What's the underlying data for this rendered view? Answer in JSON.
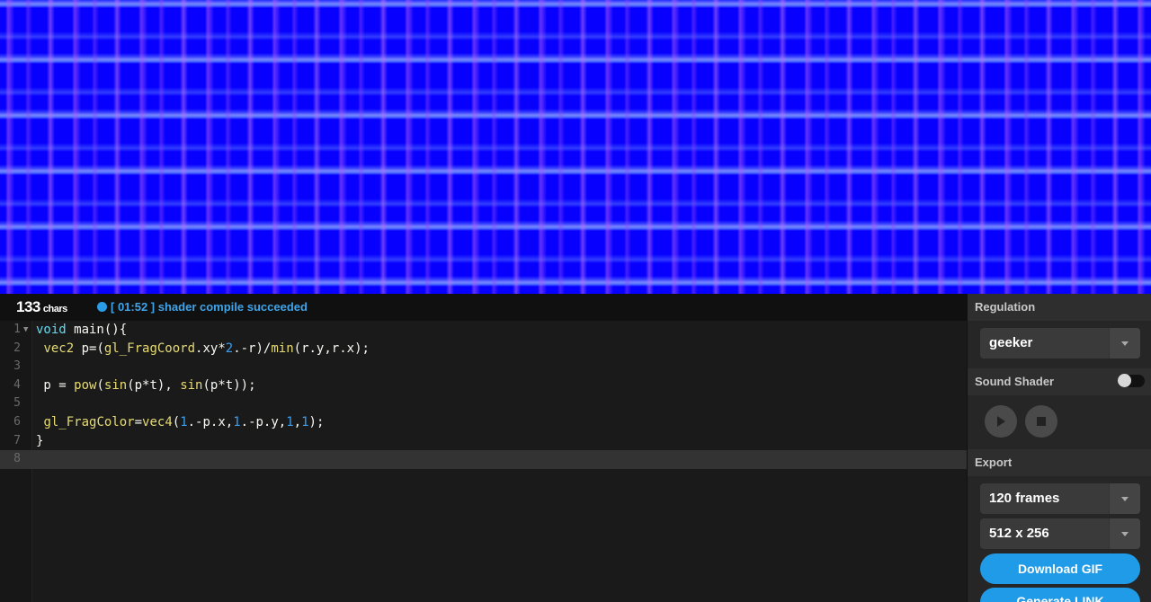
{
  "status_bar": {
    "char_count": "133",
    "char_unit": "chars",
    "message": "[ 01:52 ] shader compile succeeded"
  },
  "editor": {
    "line_numbers": [
      "1",
      "2",
      "3",
      "4",
      "5",
      "6",
      "7",
      "8"
    ],
    "active_line": 8
  },
  "panel": {
    "regulation": {
      "label": "Regulation",
      "selected": "geeker"
    },
    "sound_shader": {
      "label": "Sound Shader",
      "enabled": false
    },
    "export": {
      "label": "Export",
      "frames_selected": "120 frames",
      "size_selected": "512 x 256",
      "download_label": "Download GIF",
      "link_label": "Generate LINK"
    }
  },
  "colors": {
    "accent": "#1f9be8",
    "preview_base": "#0700ff"
  },
  "icons": [
    "play-icon",
    "stop-icon",
    "chevron-down-icon",
    "status-dot-icon"
  ]
}
